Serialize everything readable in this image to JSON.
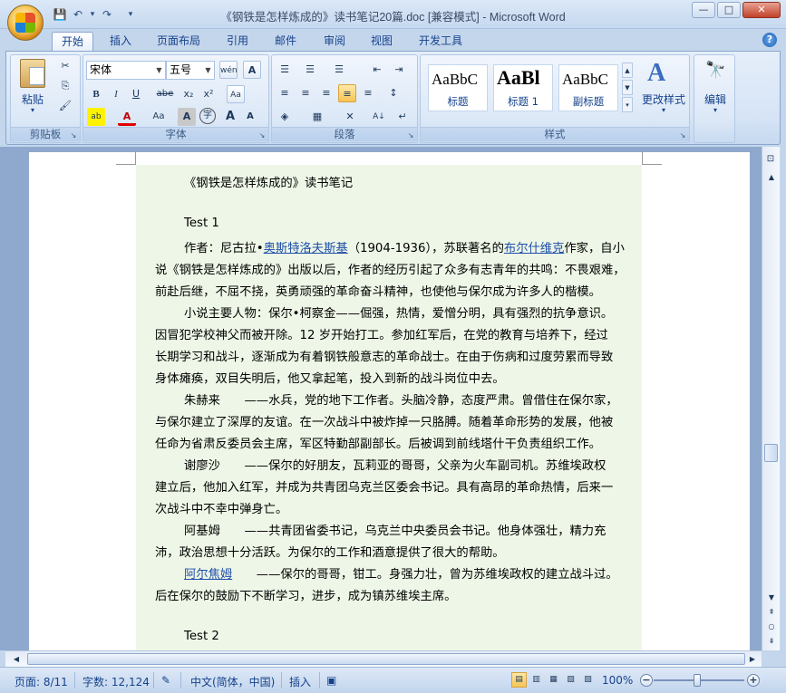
{
  "window": {
    "title": "《钢铁是怎样炼成的》读书笔记20篇.doc [兼容模式] - Microsoft Word",
    "minimize": "—",
    "maximize": "□",
    "close": "✕"
  },
  "quick_access": {
    "save_icon": "💾",
    "undo_icon": "↶",
    "undo_drop": "▾",
    "redo_icon": "↷",
    "customize_icon": "▾"
  },
  "tabs": [
    {
      "label": "开始",
      "active": true
    },
    {
      "label": "插入"
    },
    {
      "label": "页面布局"
    },
    {
      "label": "引用"
    },
    {
      "label": "邮件"
    },
    {
      "label": "审阅"
    },
    {
      "label": "视图"
    },
    {
      "label": "开发工具"
    }
  ],
  "help": "?",
  "ribbon": {
    "clipboard": {
      "label": "剪贴板",
      "paste": "粘贴",
      "paste_drop": "▾",
      "cut": "✂",
      "copy": "⎘",
      "format_painter": "🖌"
    },
    "font": {
      "label": "字体",
      "font_name": "宋体",
      "font_size": "五号",
      "phonetic": "wén",
      "border_char": "A",
      "bold": "B",
      "italic": "I",
      "underline": "U",
      "strike": "abe",
      "subscript": "x₂",
      "superscript": "x²",
      "clear_format": "Aa",
      "highlight": "ab",
      "font_color": "A",
      "change_case": "Aa",
      "char_shading": "A",
      "enclose": "字",
      "grow": "A",
      "shrink": "A"
    },
    "paragraph": {
      "label": "段落",
      "bullets": "☰",
      "numbering": "☰",
      "multilevel": "☰",
      "dec_indent": "⇤",
      "inc_indent": "⇥",
      "align_left": "≡",
      "center": "≡",
      "align_right": "≡",
      "justify": "≡",
      "distribute": "≡",
      "line_spacing": "↕",
      "shading": "◈",
      "borders": "▦",
      "asian_layout": "✕",
      "sort": "A↓",
      "show_marks": "↵"
    },
    "styles": {
      "label": "样式",
      "items": [
        {
          "sample": "AaBbC",
          "name": "标题"
        },
        {
          "sample": "AaBl",
          "name": "标题 1"
        },
        {
          "sample": "AaBbC",
          "name": "副标题"
        }
      ],
      "change_styles": "更改样式",
      "change_styles_icon": "A"
    },
    "editing": {
      "label": "编辑",
      "icon": "🔭"
    }
  },
  "document": {
    "title_line": "《钢铁是怎样炼成的》读书笔记",
    "test1": "Test 1",
    "author_prefix": "作者：尼古拉•",
    "author_link": "奥斯特洛夫斯基",
    "author_mid": "（1904-1936），苏联著名的",
    "author_link2": "布尔什维克",
    "author_suffix": "作家，自小",
    "p1_l2": "说《钢铁是怎样炼成的》出版以后，作者的经历引起了众多有志青年的共鸣：不畏艰难，",
    "p1_l3": "前赴后继，不屈不挠，英勇顽强的革命奋斗精神，也使他与保尔成为许多人的楷模。",
    "p2_l1": "小说主要人物：保尔•柯察金——倔强，热情，爱憎分明，具有强烈的抗争意识。",
    "p2_l2": "因冒犯学校神父而被开除。12 岁开始打工。参加红军后，在党的教育与培养下，经过",
    "p2_l3": "长期学习和战斗，逐渐成为有着钢铁般意志的革命战士。在由于伤病和过度劳累而导致",
    "p2_l4": "身体瘫痪，双目失明后，他又拿起笔，投入到新的战斗岗位中去。",
    "p3_l1": "朱赫来　　——水兵，党的地下工作者。头脑冷静，态度严肃。曾借住在保尔家，",
    "p3_l2": "与保尔建立了深厚的友谊。在一次战斗中被炸掉一只胳膊。随着革命形势的发展，他被",
    "p3_l3": "任命为省肃反委员会主席，军区特勤部副部长。后被调到前线塔什干负责组织工作。",
    "p4_l1": "谢廖沙　　——保尔的好朋友，瓦莉亚的哥哥，父亲为火车副司机。苏维埃政权",
    "p4_l2": "建立后，他加入红军，并成为共青团乌克兰区委会书记。具有高昂的革命热情，后来一",
    "p4_l3": "次战斗中不幸中弹身亡。",
    "p5_l1": "阿基姆　　——共青团省委书记，乌克兰中央委员会书记。他身体强壮，精力充",
    "p5_l2": "沛，政治思想十分活跃。为保尔的工作和酒意提供了很大的帮助。",
    "p6_link": "阿尔焦姆",
    "p6_l1_rest": "　　——保尔的哥哥，钳工。身强力壮，曾为苏维埃政权的建立战斗过。",
    "p6_l2": "后在保尔的鼓励下不断学习，进步，成为镇苏维埃主席。",
    "test2": "Test 2"
  },
  "scrollbar": {
    "up": "▲",
    "down": "▼",
    "left": "◀",
    "right": "▶",
    "prev_page": "⇞",
    "select_browse": "○",
    "next_page": "⇟",
    "ruler": "⊡"
  },
  "status": {
    "page": "页面: 8/11",
    "words": "字数: 12,124",
    "proof_icon": "✎",
    "language": "中文(简体，中国)",
    "insert_mode": "插入",
    "macro_icon": "▣",
    "zoom": "100%",
    "zoom_out": "−",
    "zoom_in": "+",
    "views": [
      "▤",
      "▥",
      "▦",
      "▧",
      "▨"
    ]
  }
}
